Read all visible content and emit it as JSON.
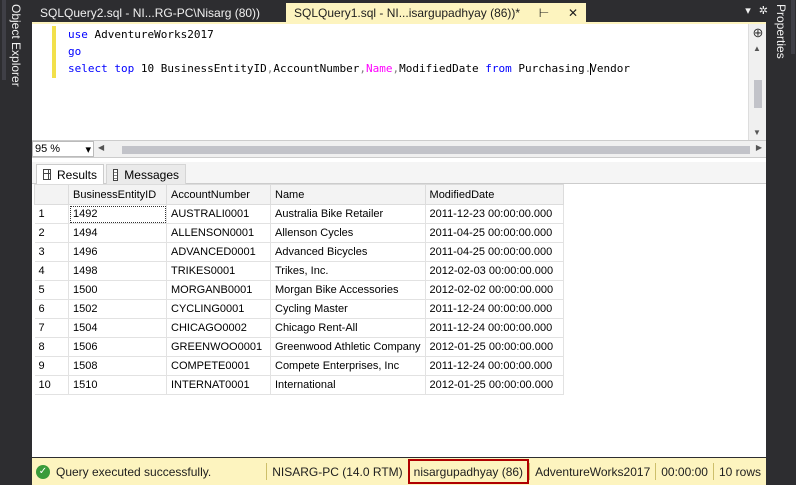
{
  "side_panels": {
    "left_label": "Object Explorer",
    "right_label": "Properties"
  },
  "tabs": [
    {
      "label": "SQLQuery2.sql - NI...RG-PC\\Nisarg (80))",
      "active": false
    },
    {
      "label": "SQLQuery1.sql - NI...isargupadhyay (86))*",
      "active": true
    }
  ],
  "editor": {
    "line1_kw": "use",
    "line1_rest": " AdventureWorks2017",
    "line2_kw": "go",
    "line3": {
      "select": "select",
      "top": "top",
      "n": " 10 BusinessEntityID",
      "comma1": ",",
      "acct": "AccountNumber",
      "comma2": ",",
      "name": "Name",
      "comma3": ",",
      "mod": "ModifiedDate ",
      "from": "from",
      "tbl1": " Purchasing",
      "dot": ".",
      "tbl2": "Vendor"
    }
  },
  "zoom": {
    "value": "95 %"
  },
  "results_tabs": {
    "results": "Results",
    "messages": "Messages"
  },
  "grid": {
    "columns": [
      "BusinessEntityID",
      "AccountNumber",
      "Name",
      "ModifiedDate"
    ],
    "rows": [
      [
        "1",
        "1492",
        "AUSTRALI0001",
        "Australia Bike Retailer",
        "2011-12-23 00:00:00.000"
      ],
      [
        "2",
        "1494",
        "ALLENSON0001",
        "Allenson Cycles",
        "2011-04-25 00:00:00.000"
      ],
      [
        "3",
        "1496",
        "ADVANCED0001",
        "Advanced Bicycles",
        "2011-04-25 00:00:00.000"
      ],
      [
        "4",
        "1498",
        "TRIKES0001",
        "Trikes, Inc.",
        "2012-02-03 00:00:00.000"
      ],
      [
        "5",
        "1500",
        "MORGANB0001",
        "Morgan Bike Accessories",
        "2012-02-02 00:00:00.000"
      ],
      [
        "6",
        "1502",
        "CYCLING0001",
        "Cycling Master",
        "2011-12-24 00:00:00.000"
      ],
      [
        "7",
        "1504",
        "CHICAGO0002",
        "Chicago Rent-All",
        "2011-12-24 00:00:00.000"
      ],
      [
        "8",
        "1506",
        "GREENWOO0001",
        "Greenwood Athletic Company",
        "2012-01-25 00:00:00.000"
      ],
      [
        "9",
        "1508",
        "COMPETE0001",
        "Compete Enterprises, Inc",
        "2011-12-24 00:00:00.000"
      ],
      [
        "10",
        "1510",
        "INTERNAT0001",
        "International",
        "2012-01-25 00:00:00.000"
      ]
    ]
  },
  "status": {
    "message": "Query executed successfully.",
    "server": "NISARG-PC (14.0 RTM)",
    "user": "nisargupadhyay (86)",
    "database": "AdventureWorks2017",
    "elapsed": "00:00:00",
    "rows": "10 rows"
  },
  "colors": {
    "accent": "#fdf4bf",
    "highlight_border": "#b00000",
    "keyword": "#0000ff",
    "function": "#ff00ff"
  },
  "icons": {
    "close": "close-icon",
    "pin": "pin-icon",
    "dropdown": "chevron-down-icon",
    "success": "check-icon"
  }
}
